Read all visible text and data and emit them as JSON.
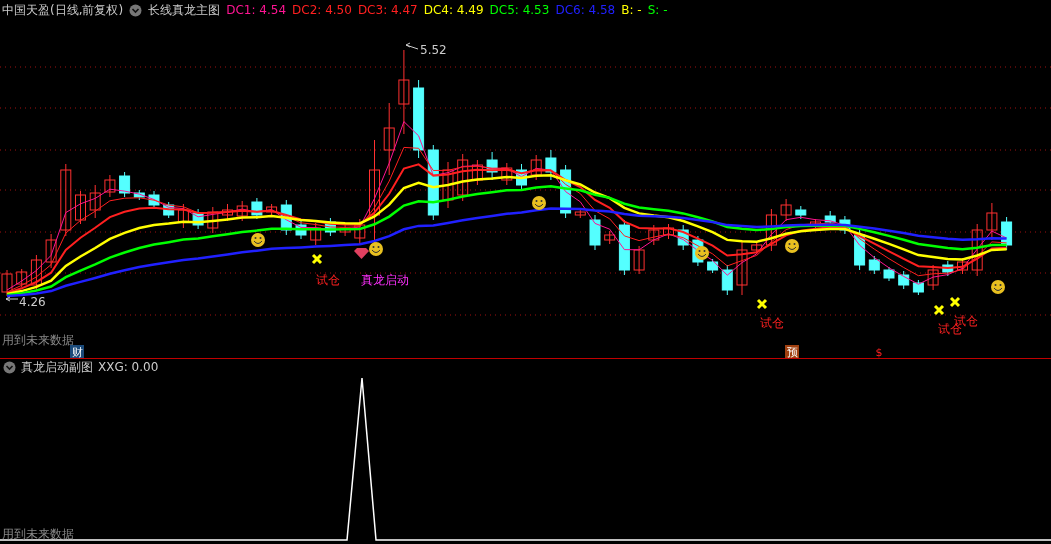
{
  "header": {
    "instrument": "中国天盈(日线,前复权)",
    "indicator_title": "长线真龙主图",
    "readings": [
      {
        "label": "DC1:",
        "value": "4.54",
        "color": "#ff1493"
      },
      {
        "label": "DC2:",
        "value": "4.50",
        "color": "#ff2020"
      },
      {
        "label": "DC3:",
        "value": "4.47",
        "color": "#ff2020"
      },
      {
        "label": "DC4:",
        "value": "4.49",
        "color": "#ffff00"
      },
      {
        "label": "DC5:",
        "value": "4.53",
        "color": "#00ff00"
      },
      {
        "label": "DC6:",
        "value": "4.58",
        "color": "#2020ff"
      },
      {
        "label": "B:",
        "value": "-",
        "color": "#ffff00"
      },
      {
        "label": "S:",
        "value": "-",
        "color": "#00ff00"
      }
    ]
  },
  "main_chart": {
    "high_label": "5.52",
    "low_label": "4.26",
    "signals": [
      {
        "kind": "trial",
        "text": "试仓"
      },
      {
        "kind": "launch",
        "text": "真龙启动"
      },
      {
        "kind": "trial",
        "text": "试仓"
      },
      {
        "kind": "trial",
        "text": "试仓"
      },
      {
        "kind": "trial",
        "text": "试仓"
      }
    ],
    "note": "用到未来数据",
    "badges": [
      {
        "kind": "finance",
        "text": "财"
      },
      {
        "kind": "forecast",
        "text": "预"
      },
      {
        "kind": "dollar",
        "text": "$"
      }
    ]
  },
  "sub_chart": {
    "title": "真龙启动副图",
    "reading": "XXG: 0.00",
    "note": "用到未来数据"
  }
}
